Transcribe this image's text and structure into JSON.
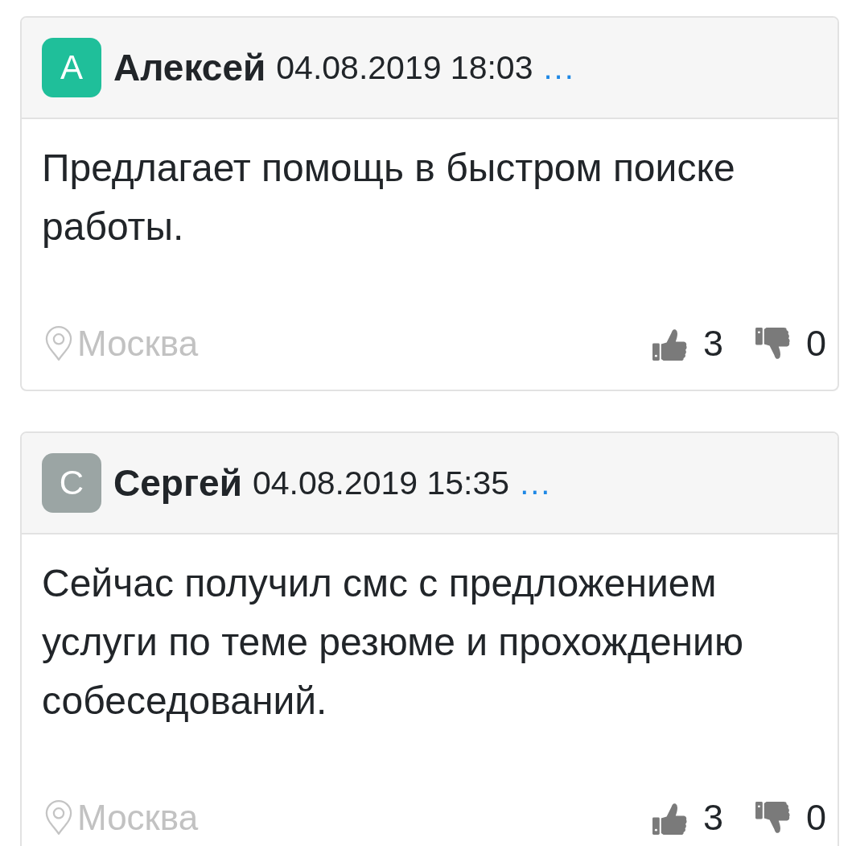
{
  "comments": [
    {
      "avatar": {
        "letter": "А",
        "color": "#1fbf9a"
      },
      "author": "Алексей",
      "date": "04.08.2019 18:03",
      "more": "...",
      "text": "Предлагает помощь в быстром поиске работы.",
      "location": "Москва",
      "likes": "3",
      "dislikes": "0"
    },
    {
      "avatar": {
        "letter": "С",
        "color": "#9ba5a4"
      },
      "author": "Сергей",
      "date": "04.08.2019 15:35",
      "more": "...",
      "text": "Сейчас получил смс с предложением услуги по теме резюме и прохождению собеседований.",
      "location": "Москва",
      "likes": "3",
      "dislikes": "0"
    }
  ]
}
